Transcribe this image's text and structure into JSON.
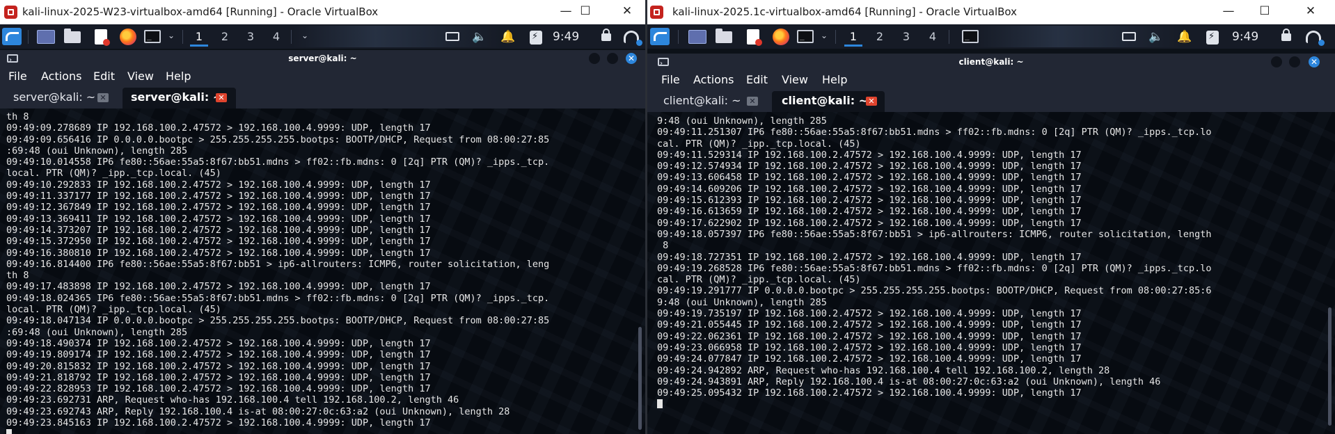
{
  "left": {
    "window_title": "kali-linux-2025-W23-virtualbox-amd64 [Running] - Oracle VirtualBox",
    "controls": {
      "minimize": "—",
      "maximize": "☐",
      "close": "✕"
    },
    "panel": {
      "workspaces": [
        "1",
        "2",
        "3",
        "4"
      ],
      "active_workspace": "1",
      "clock": "9:49"
    },
    "terminal": {
      "title": "server@kali: ~",
      "menu": [
        "File",
        "Actions",
        "Edit",
        "View",
        "Help"
      ],
      "tabs": [
        {
          "label": "server@kali: ~",
          "active": false
        },
        {
          "label": "server@kali: ~",
          "active": true
        }
      ],
      "output": "th 8\n09:49:09.278689 IP 192.168.100.2.47572 > 192.168.100.4.9999: UDP, length 17\n09:49:09.656416 IP 0.0.0.0.bootpc > 255.255.255.255.bootps: BOOTP/DHCP, Request from 08:00:27:85\n:69:48 (oui Unknown), length 285\n09:49:10.014558 IP6 fe80::56ae:55a5:8f67:bb51.mdns > ff02::fb.mdns: 0 [2q] PTR (QM)? _ipps._tcp.\nlocal. PTR (QM)? _ipp._tcp.local. (45)\n09:49:10.292833 IP 192.168.100.2.47572 > 192.168.100.4.9999: UDP, length 17\n09:49:11.337177 IP 192.168.100.2.47572 > 192.168.100.4.9999: UDP, length 17\n09:49:12.367849 IP 192.168.100.2.47572 > 192.168.100.4.9999: UDP, length 17\n09:49:13.369411 IP 192.168.100.2.47572 > 192.168.100.4.9999: UDP, length 17\n09:49:14.373207 IP 192.168.100.2.47572 > 192.168.100.4.9999: UDP, length 17\n09:49:15.372950 IP 192.168.100.2.47572 > 192.168.100.4.9999: UDP, length 17\n09:49:16.380810 IP 192.168.100.2.47572 > 192.168.100.4.9999: UDP, length 17\n09:49:16.814400 IP6 fe80::56ae:55a5:8f67:bb51 > ip6-allrouters: ICMP6, router solicitation, leng\nth 8\n09:49:17.483898 IP 192.168.100.2.47572 > 192.168.100.4.9999: UDP, length 17\n09:49:18.024365 IP6 fe80::56ae:55a5:8f67:bb51.mdns > ff02::fb.mdns: 0 [2q] PTR (QM)? _ipps._tcp.\nlocal. PTR (QM)? _ipp._tcp.local. (45)\n09:49:18.047134 IP 0.0.0.0.bootpc > 255.255.255.255.bootps: BOOTP/DHCP, Request from 08:00:27:85\n:69:48 (oui Unknown), length 285\n09:49:18.490374 IP 192.168.100.2.47572 > 192.168.100.4.9999: UDP, length 17\n09:49:19.809174 IP 192.168.100.2.47572 > 192.168.100.4.9999: UDP, length 17\n09:49:20.815832 IP 192.168.100.2.47572 > 192.168.100.4.9999: UDP, length 17\n09:49:21.818792 IP 192.168.100.2.47572 > 192.168.100.4.9999: UDP, length 17\n09:49:22.828953 IP 192.168.100.2.47572 > 192.168.100.4.9999: UDP, length 17\n09:49:23.692731 ARP, Request who-has 192.168.100.4 tell 192.168.100.2, length 46\n09:49:23.692743 ARP, Reply 192.168.100.4 is-at 08:00:27:0c:63:a2 (oui Unknown), length 28\n09:49:23.845163 IP 192.168.100.2.47572 > 192.168.100.4.9999: UDP, length 17\n"
    }
  },
  "right": {
    "window_title": "kali-linux-2025.1c-virtualbox-amd64 [Running] - Oracle VirtualBox",
    "controls": {
      "minimize": "—",
      "maximize": "☐",
      "close": "✕"
    },
    "panel": {
      "workspaces": [
        "1",
        "2",
        "3",
        "4"
      ],
      "active_workspace": "1",
      "clock": "9:49"
    },
    "terminal": {
      "title": "client@kali: ~",
      "menu": [
        "File",
        "Actions",
        "Edit",
        "View",
        "Help"
      ],
      "tabs": [
        {
          "label": "client@kali: ~",
          "active": false
        },
        {
          "label": "client@kali: ~",
          "active": true
        }
      ],
      "output": "9:48 (oui Unknown), length 285\n09:49:11.251307 IP6 fe80::56ae:55a5:8f67:bb51.mdns > ff02::fb.mdns: 0 [2q] PTR (QM)? _ipps._tcp.lo\ncal. PTR (QM)? _ipp._tcp.local. (45)\n09:49:11.529314 IP 192.168.100.2.47572 > 192.168.100.4.9999: UDP, length 17\n09:49:12.574934 IP 192.168.100.2.47572 > 192.168.100.4.9999: UDP, length 17\n09:49:13.606458 IP 192.168.100.2.47572 > 192.168.100.4.9999: UDP, length 17\n09:49:14.609206 IP 192.168.100.2.47572 > 192.168.100.4.9999: UDP, length 17\n09:49:15.612393 IP 192.168.100.2.47572 > 192.168.100.4.9999: UDP, length 17\n09:49:16.613659 IP 192.168.100.2.47572 > 192.168.100.4.9999: UDP, length 17\n09:49:17.622902 IP 192.168.100.2.47572 > 192.168.100.4.9999: UDP, length 17\n09:49:18.057397 IP6 fe80::56ae:55a5:8f67:bb51 > ip6-allrouters: ICMP6, router solicitation, length\n 8\n09:49:18.727351 IP 192.168.100.2.47572 > 192.168.100.4.9999: UDP, length 17\n09:49:19.268528 IP6 fe80::56ae:55a5:8f67:bb51.mdns > ff02::fb.mdns: 0 [2q] PTR (QM)? _ipps._tcp.lo\ncal. PTR (QM)? _ipp._tcp.local. (45)\n09:49:19.291777 IP 0.0.0.0.bootpc > 255.255.255.255.bootps: BOOTP/DHCP, Request from 08:00:27:85:6\n9:48 (oui Unknown), length 285\n09:49:19.735197 IP 192.168.100.2.47572 > 192.168.100.4.9999: UDP, length 17\n09:49:21.055445 IP 192.168.100.2.47572 > 192.168.100.4.9999: UDP, length 17\n09:49:22.062361 IP 192.168.100.2.47572 > 192.168.100.4.9999: UDP, length 17\n09:49:23.066958 IP 192.168.100.2.47572 > 192.168.100.4.9999: UDP, length 17\n09:49:24.077847 IP 192.168.100.2.47572 > 192.168.100.4.9999: UDP, length 17\n09:49:24.942892 ARP, Request who-has 192.168.100.4 tell 192.168.100.2, length 28\n09:49:24.943891 ARP, Reply 192.168.100.4 is-at 08:00:27:0c:63:a2 (oui Unknown), length 46\n09:49:25.095432 IP 192.168.100.2.47572 > 192.168.100.4.9999: UDP, length 17\n"
    }
  },
  "icons": [
    "virtualbox-icon",
    "kali-menu-icon",
    "desktop-icon",
    "file-manager-icon",
    "text-editor-icon",
    "firefox-icon",
    "terminal-icon",
    "display-icon",
    "volume-icon",
    "notification-bell-icon",
    "battery-icon",
    "lock-icon",
    "network-icon"
  ],
  "colors": {
    "accent": "#2d86dc",
    "terminal_bg": "#0f131b",
    "tab_close_active": "#e0442e",
    "vbox_red": "#c4231e"
  }
}
